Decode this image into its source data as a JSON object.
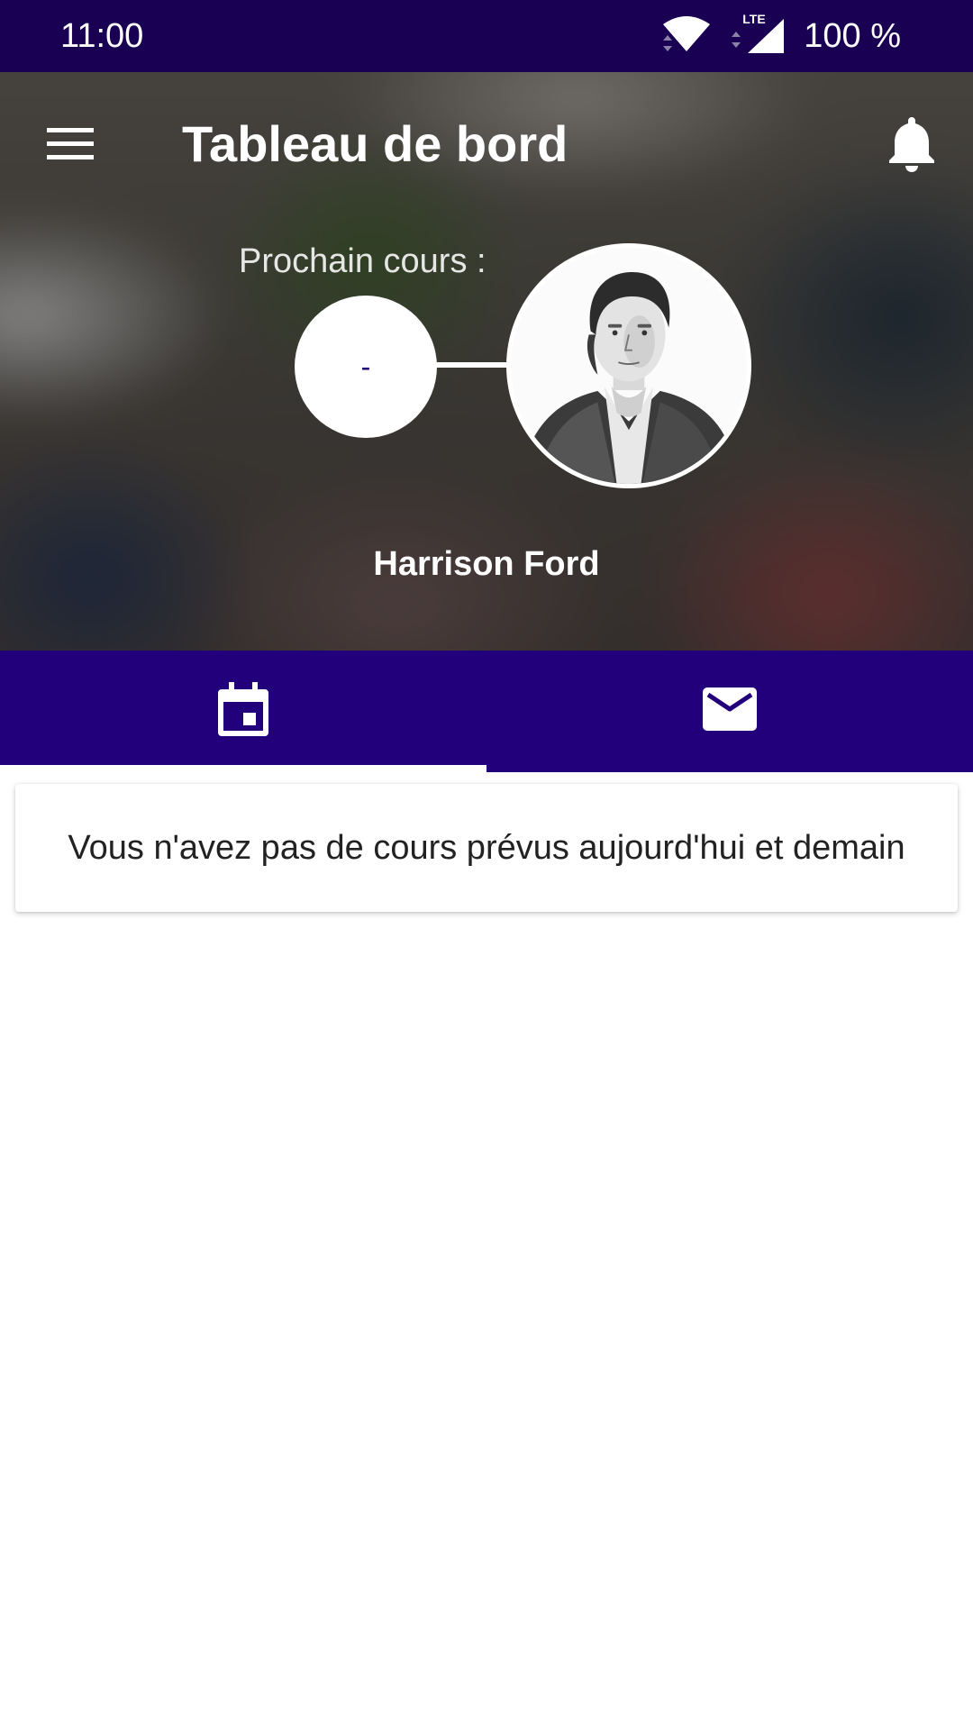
{
  "status_bar": {
    "time": "11:00",
    "battery": "100 %",
    "network_label": "LTE"
  },
  "header": {
    "title": "Tableau de bord"
  },
  "next_class": {
    "label": "Prochain cours :",
    "value": "-"
  },
  "user": {
    "name": "Harrison Ford"
  },
  "tabs": [
    {
      "icon": "calendar-icon",
      "selected": true
    },
    {
      "icon": "mail-icon",
      "selected": false
    }
  ],
  "card": {
    "message": "Vous n'avez pas de cours prévus aujourd'hui et demain"
  },
  "colors": {
    "status_bar": "#1a0052",
    "primary": "#23007b",
    "on_primary": "#ffffff"
  }
}
